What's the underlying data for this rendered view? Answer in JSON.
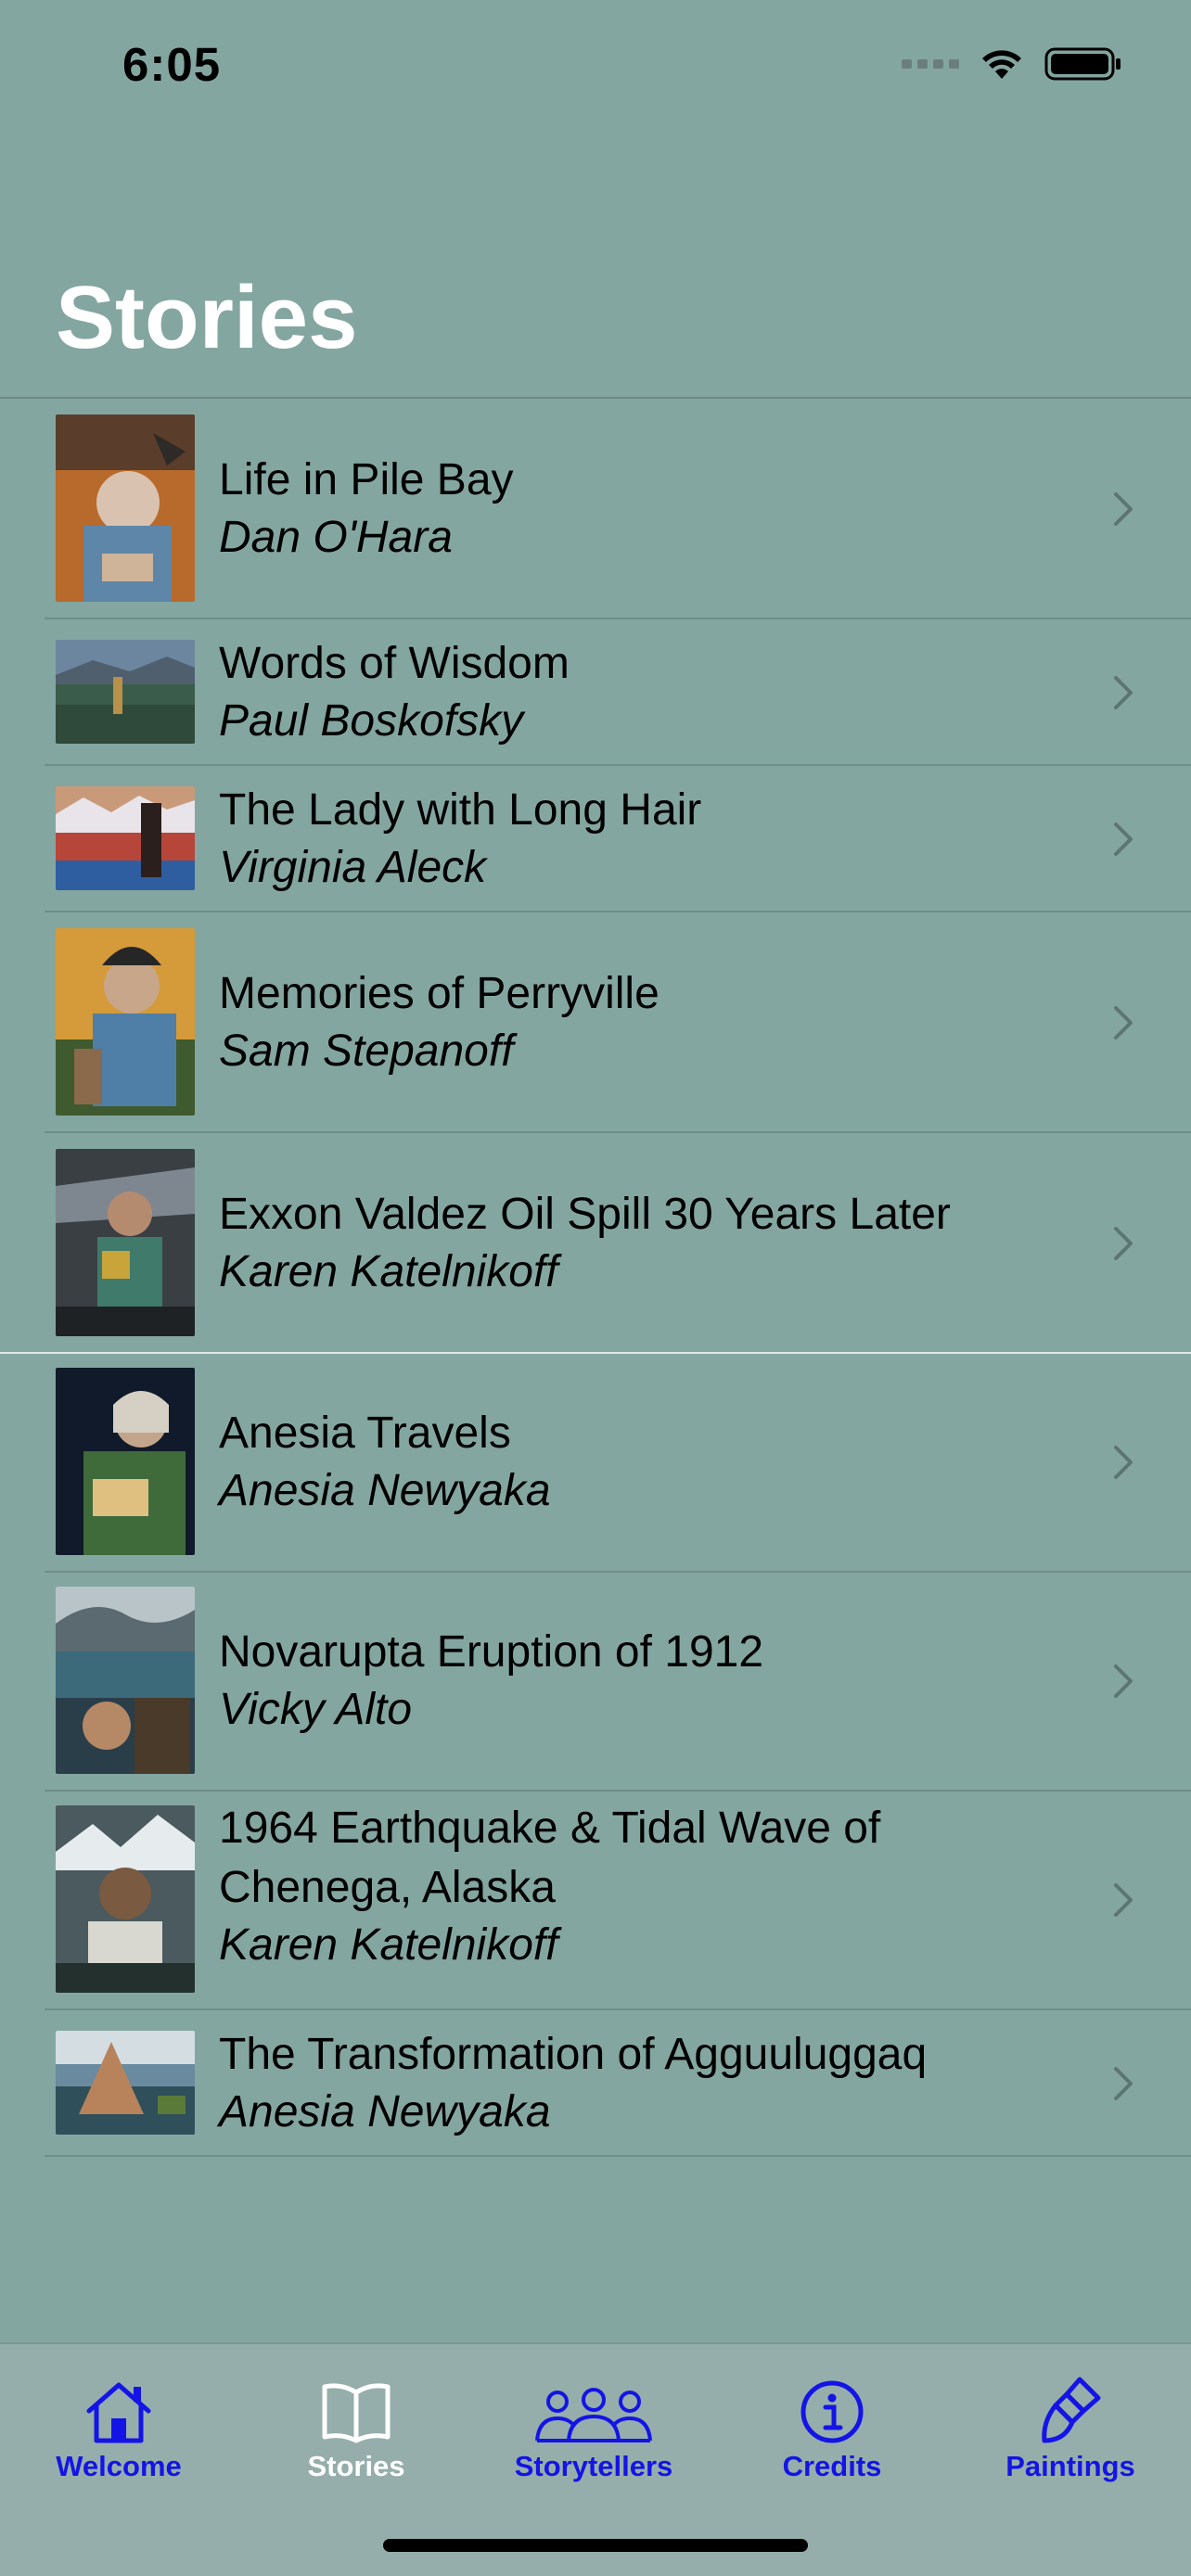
{
  "status_bar": {
    "time": "6:05"
  },
  "page": {
    "title": "Stories"
  },
  "stories": [
    {
      "title": "Life in Pile Bay",
      "author": "Dan O'Hara"
    },
    {
      "title": "Words of Wisdom",
      "author": "Paul Boskofsky"
    },
    {
      "title": "The Lady with Long Hair",
      "author": "Virginia Aleck"
    },
    {
      "title": "Memories of Perryville",
      "author": "Sam Stepanoff"
    },
    {
      "title": "Exxon Valdez Oil Spill 30 Years Later",
      "author": "Karen Katelnikoff"
    },
    {
      "title": "Anesia Travels",
      "author": "Anesia Newyaka"
    },
    {
      "title": "Novarupta Eruption of 1912",
      "author": "Vicky Alto"
    },
    {
      "title": "1964 Earthquake & Tidal Wave of Chenega, Alaska",
      "author": "Karen Katelnikoff"
    },
    {
      "title": "The Transformation of Agguuluggaq",
      "author": "Anesia Newyaka"
    }
  ],
  "tabs": [
    {
      "label": "Welcome",
      "icon": "house-icon",
      "selected": false
    },
    {
      "label": "Stories",
      "icon": "book-icon",
      "selected": true
    },
    {
      "label": "Storytellers",
      "icon": "people-icon",
      "selected": false
    },
    {
      "label": "Credits",
      "icon": "info-circle-icon",
      "selected": false
    },
    {
      "label": "Paintings",
      "icon": "paintbrush-icon",
      "selected": false
    }
  ],
  "colors": {
    "background": "#84a6a1",
    "tab_active": "#ffffff",
    "tab_inactive": "#1414e6",
    "tab_bar": "#95aeab"
  }
}
